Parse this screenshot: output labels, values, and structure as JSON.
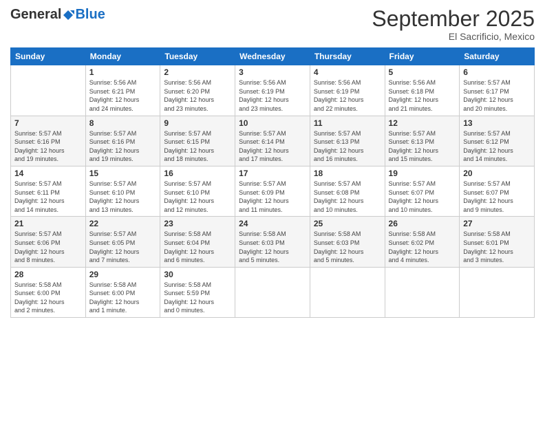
{
  "header": {
    "logo_general": "General",
    "logo_blue": "Blue",
    "month_title": "September 2025",
    "location": "El Sacrificio, Mexico"
  },
  "days_of_week": [
    "Sunday",
    "Monday",
    "Tuesday",
    "Wednesday",
    "Thursday",
    "Friday",
    "Saturday"
  ],
  "weeks": [
    [
      {
        "day": "",
        "info": ""
      },
      {
        "day": "1",
        "info": "Sunrise: 5:56 AM\nSunset: 6:21 PM\nDaylight: 12 hours\nand 24 minutes."
      },
      {
        "day": "2",
        "info": "Sunrise: 5:56 AM\nSunset: 6:20 PM\nDaylight: 12 hours\nand 23 minutes."
      },
      {
        "day": "3",
        "info": "Sunrise: 5:56 AM\nSunset: 6:19 PM\nDaylight: 12 hours\nand 23 minutes."
      },
      {
        "day": "4",
        "info": "Sunrise: 5:56 AM\nSunset: 6:19 PM\nDaylight: 12 hours\nand 22 minutes."
      },
      {
        "day": "5",
        "info": "Sunrise: 5:56 AM\nSunset: 6:18 PM\nDaylight: 12 hours\nand 21 minutes."
      },
      {
        "day": "6",
        "info": "Sunrise: 5:57 AM\nSunset: 6:17 PM\nDaylight: 12 hours\nand 20 minutes."
      }
    ],
    [
      {
        "day": "7",
        "info": "Sunrise: 5:57 AM\nSunset: 6:16 PM\nDaylight: 12 hours\nand 19 minutes."
      },
      {
        "day": "8",
        "info": "Sunrise: 5:57 AM\nSunset: 6:16 PM\nDaylight: 12 hours\nand 19 minutes."
      },
      {
        "day": "9",
        "info": "Sunrise: 5:57 AM\nSunset: 6:15 PM\nDaylight: 12 hours\nand 18 minutes."
      },
      {
        "day": "10",
        "info": "Sunrise: 5:57 AM\nSunset: 6:14 PM\nDaylight: 12 hours\nand 17 minutes."
      },
      {
        "day": "11",
        "info": "Sunrise: 5:57 AM\nSunset: 6:13 PM\nDaylight: 12 hours\nand 16 minutes."
      },
      {
        "day": "12",
        "info": "Sunrise: 5:57 AM\nSunset: 6:13 PM\nDaylight: 12 hours\nand 15 minutes."
      },
      {
        "day": "13",
        "info": "Sunrise: 5:57 AM\nSunset: 6:12 PM\nDaylight: 12 hours\nand 14 minutes."
      }
    ],
    [
      {
        "day": "14",
        "info": "Sunrise: 5:57 AM\nSunset: 6:11 PM\nDaylight: 12 hours\nand 14 minutes."
      },
      {
        "day": "15",
        "info": "Sunrise: 5:57 AM\nSunset: 6:10 PM\nDaylight: 12 hours\nand 13 minutes."
      },
      {
        "day": "16",
        "info": "Sunrise: 5:57 AM\nSunset: 6:10 PM\nDaylight: 12 hours\nand 12 minutes."
      },
      {
        "day": "17",
        "info": "Sunrise: 5:57 AM\nSunset: 6:09 PM\nDaylight: 12 hours\nand 11 minutes."
      },
      {
        "day": "18",
        "info": "Sunrise: 5:57 AM\nSunset: 6:08 PM\nDaylight: 12 hours\nand 10 minutes."
      },
      {
        "day": "19",
        "info": "Sunrise: 5:57 AM\nSunset: 6:07 PM\nDaylight: 12 hours\nand 10 minutes."
      },
      {
        "day": "20",
        "info": "Sunrise: 5:57 AM\nSunset: 6:07 PM\nDaylight: 12 hours\nand 9 minutes."
      }
    ],
    [
      {
        "day": "21",
        "info": "Sunrise: 5:57 AM\nSunset: 6:06 PM\nDaylight: 12 hours\nand 8 minutes."
      },
      {
        "day": "22",
        "info": "Sunrise: 5:57 AM\nSunset: 6:05 PM\nDaylight: 12 hours\nand 7 minutes."
      },
      {
        "day": "23",
        "info": "Sunrise: 5:58 AM\nSunset: 6:04 PM\nDaylight: 12 hours\nand 6 minutes."
      },
      {
        "day": "24",
        "info": "Sunrise: 5:58 AM\nSunset: 6:03 PM\nDaylight: 12 hours\nand 5 minutes."
      },
      {
        "day": "25",
        "info": "Sunrise: 5:58 AM\nSunset: 6:03 PM\nDaylight: 12 hours\nand 5 minutes."
      },
      {
        "day": "26",
        "info": "Sunrise: 5:58 AM\nSunset: 6:02 PM\nDaylight: 12 hours\nand 4 minutes."
      },
      {
        "day": "27",
        "info": "Sunrise: 5:58 AM\nSunset: 6:01 PM\nDaylight: 12 hours\nand 3 minutes."
      }
    ],
    [
      {
        "day": "28",
        "info": "Sunrise: 5:58 AM\nSunset: 6:00 PM\nDaylight: 12 hours\nand 2 minutes."
      },
      {
        "day": "29",
        "info": "Sunrise: 5:58 AM\nSunset: 6:00 PM\nDaylight: 12 hours\nand 1 minute."
      },
      {
        "day": "30",
        "info": "Sunrise: 5:58 AM\nSunset: 5:59 PM\nDaylight: 12 hours\nand 0 minutes."
      },
      {
        "day": "",
        "info": ""
      },
      {
        "day": "",
        "info": ""
      },
      {
        "day": "",
        "info": ""
      },
      {
        "day": "",
        "info": ""
      }
    ]
  ]
}
